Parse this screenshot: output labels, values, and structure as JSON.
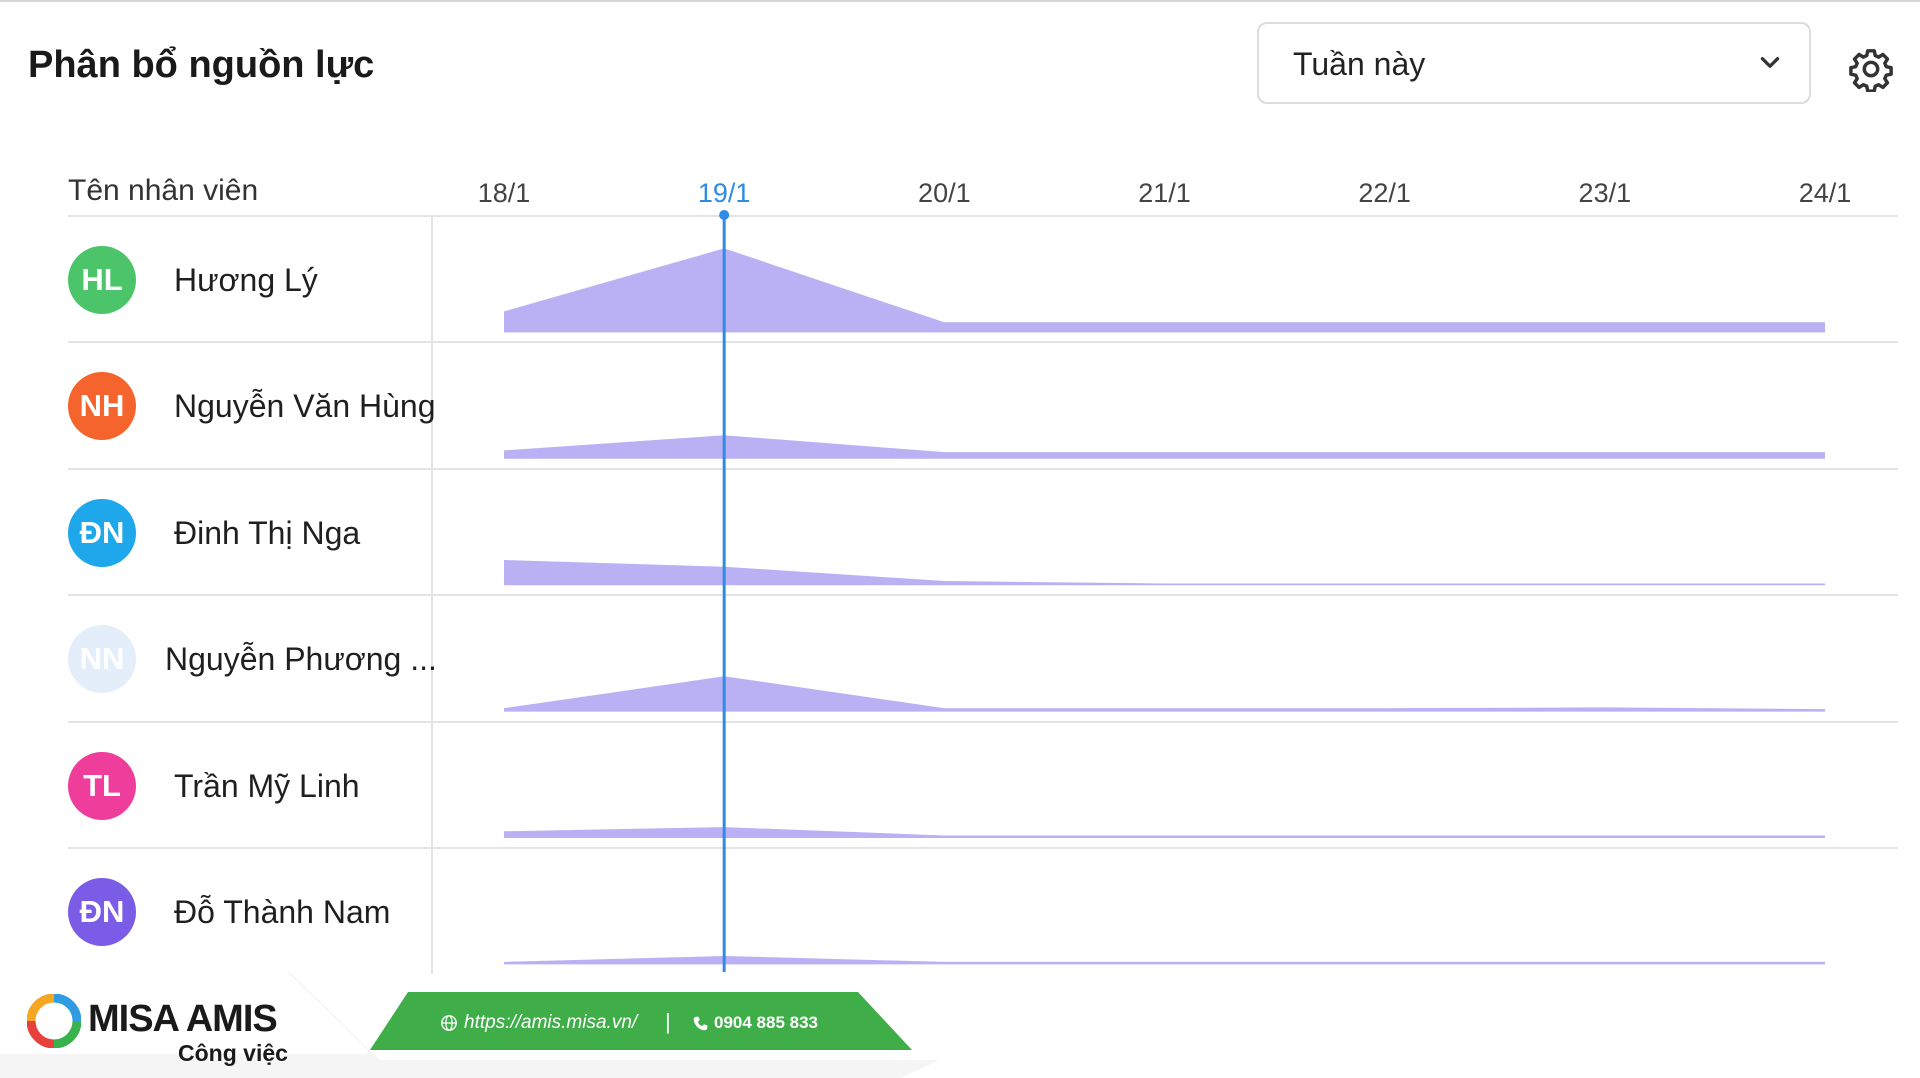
{
  "header": {
    "title": "Phân bổ nguồn lực",
    "period_select": {
      "value": "Tuần này"
    },
    "settings_icon": "gear-icon"
  },
  "table": {
    "name_column_header": "Tên nhân viên",
    "today": "19/1"
  },
  "chart_data": {
    "type": "area",
    "categories": [
      "18/1",
      "19/1",
      "20/1",
      "21/1",
      "22/1",
      "23/1",
      "24/1"
    ],
    "series": [
      {
        "initials": "HL",
        "label": "Hương Lý",
        "avatar_color": "#4cc46a",
        "values": [
          0.25,
          1.0,
          0.12,
          0.12,
          0.12,
          0.12,
          0.12
        ]
      },
      {
        "initials": "NH",
        "label": "Nguyễn Văn Hùng",
        "avatar_color": "#f4642c",
        "values": [
          0.1,
          0.28,
          0.08,
          0.08,
          0.08,
          0.08,
          0.08
        ]
      },
      {
        "initials": "ĐN",
        "label": "Đinh Thị Nga",
        "avatar_color": "#1ea7ea",
        "values": [
          0.3,
          0.22,
          0.05,
          0.02,
          0.02,
          0.02,
          0.02
        ]
      },
      {
        "initials": "NN",
        "label": "Nguyễn Phương ...",
        "avatar_color": "#e4eefb",
        "values": [
          0.04,
          0.42,
          0.04,
          0.04,
          0.04,
          0.05,
          0.03
        ]
      },
      {
        "initials": "TL",
        "label": "Trần Mỹ Linh",
        "avatar_color": "#ee3d9a",
        "values": [
          0.08,
          0.13,
          0.03,
          0.03,
          0.03,
          0.03,
          0.03
        ]
      },
      {
        "initials": "ĐN",
        "label": "Đỗ Thành Nam",
        "avatar_color": "#7b5ce6",
        "values": [
          0.03,
          0.1,
          0.03,
          0.03,
          0.03,
          0.03,
          0.03
        ]
      }
    ],
    "fill_color": "#b9b1f4",
    "today_line_color": "#2f8be6"
  },
  "footer": {
    "brand": "MISA AMIS",
    "product": "Công việc",
    "url": "https://amis.misa.vn/",
    "separator": "|",
    "phone": "0904 885 833",
    "green": "#3fae49"
  }
}
